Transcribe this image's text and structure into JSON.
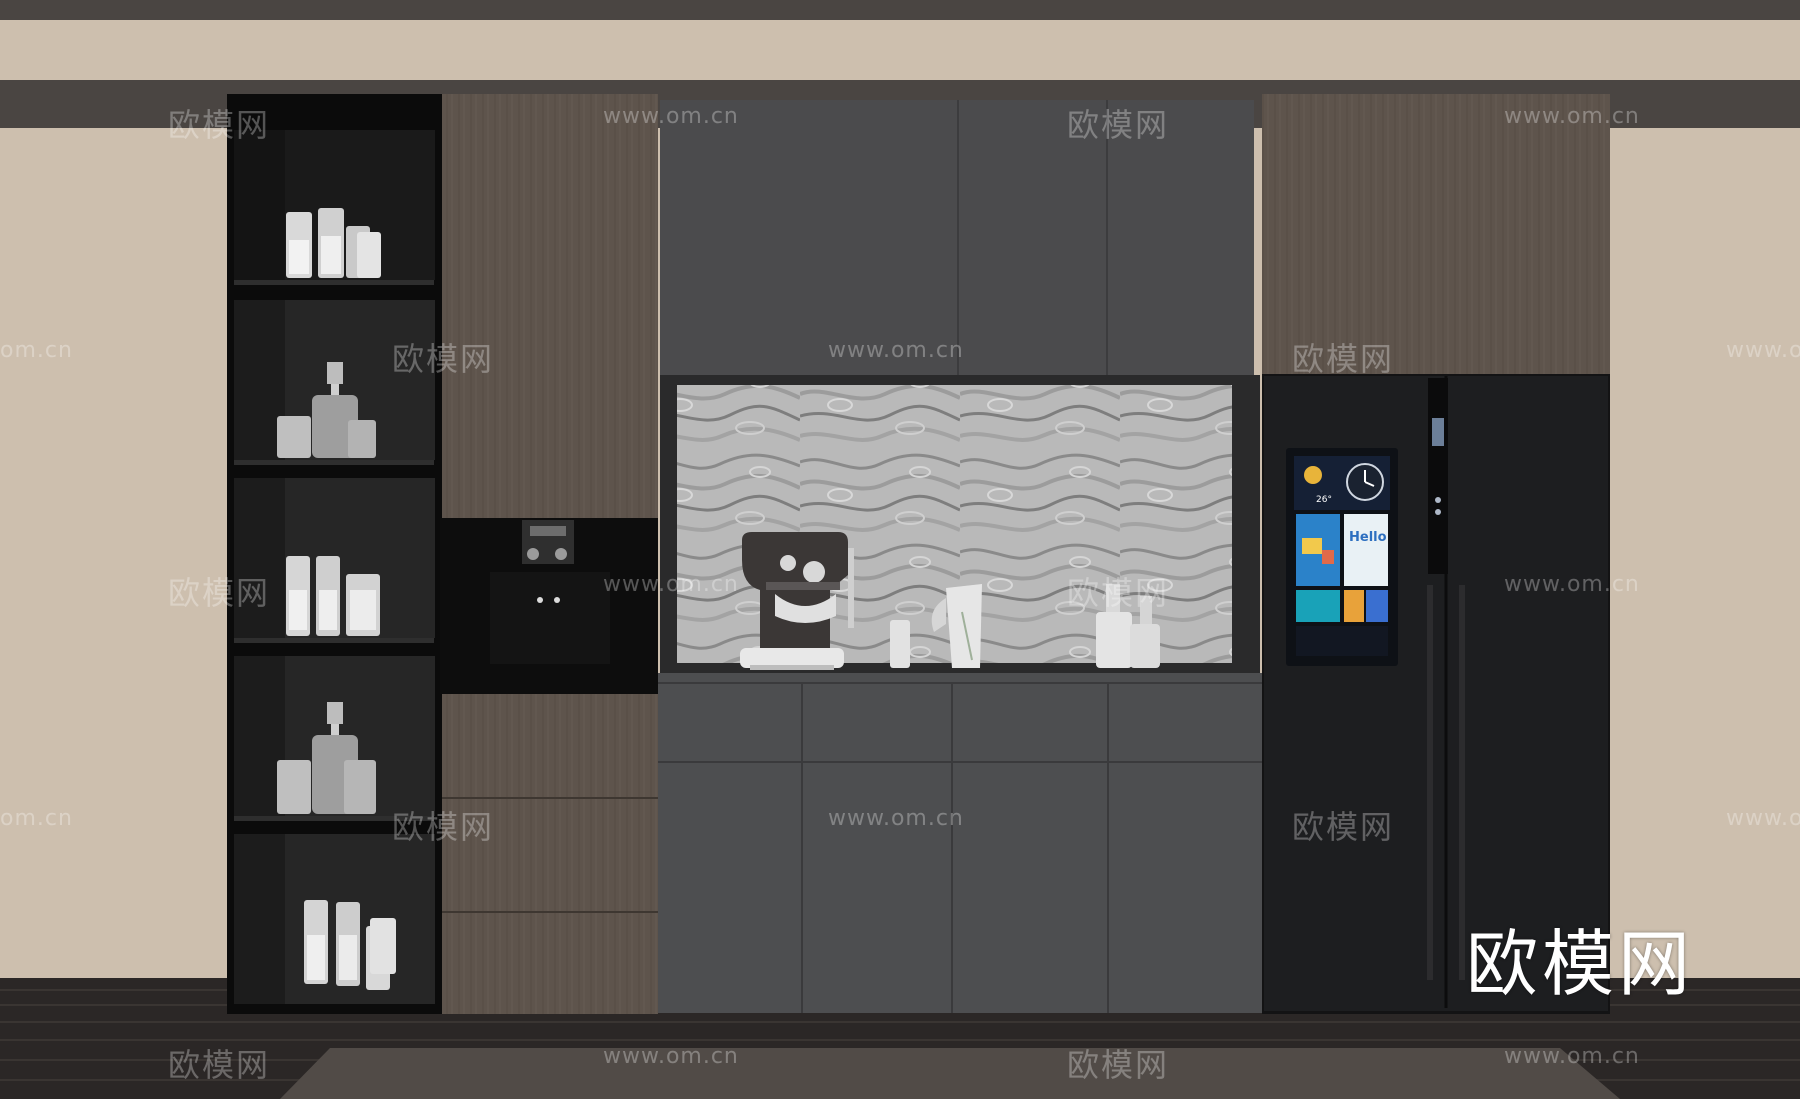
{
  "watermark": {
    "brand": "欧模网",
    "url": "www.om.cn",
    "url_cropped": "om.cn"
  },
  "fridge_screen": {
    "greeting": "Hello",
    "temperature": "26°"
  },
  "colors": {
    "wall": "#cdbfae",
    "ceiling_band": "#4a4542",
    "wood_panel": "#5e544c",
    "dark_cabinet": "#4b4b4d",
    "lower_cabinet": "#4d4e50",
    "glass_cabinet": "#0b0b0b",
    "fridge": "#1d1e20",
    "floor": "#2b2726"
  }
}
